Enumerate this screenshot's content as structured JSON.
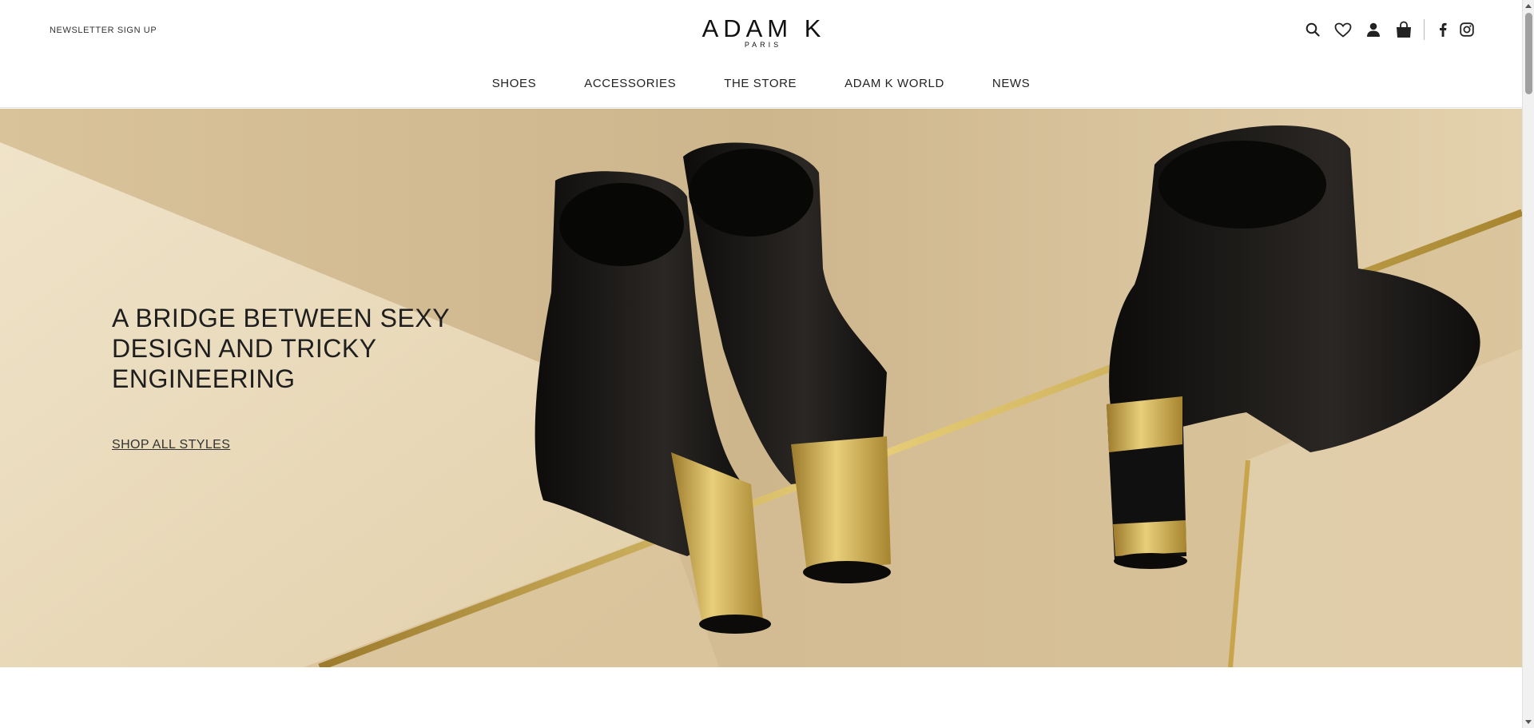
{
  "header": {
    "newsletter_label": "NEWSLETTER SIGN UP",
    "logo": {
      "main": "ADAM K",
      "sub": "PARIS"
    },
    "icons": [
      "search-icon",
      "heart-icon",
      "user-icon",
      "shopping-bag-icon",
      "facebook-icon",
      "instagram-icon"
    ]
  },
  "nav": {
    "items": [
      {
        "label": "SHOES"
      },
      {
        "label": "ACCESSORIES"
      },
      {
        "label": "THE STORE"
      },
      {
        "label": "ADAM K WORLD"
      },
      {
        "label": "NEWS"
      }
    ]
  },
  "hero": {
    "headline": "A BRIDGE BETWEEN SEXY DESIGN AND TRICKY ENGINEERING",
    "cta_label": "SHOP ALL STYLES"
  },
  "colors": {
    "hero_bg": "#d9c29c",
    "gold_accent": "#c9a23c",
    "boot_black": "#151412",
    "text_dark": "#1e1e1e"
  }
}
